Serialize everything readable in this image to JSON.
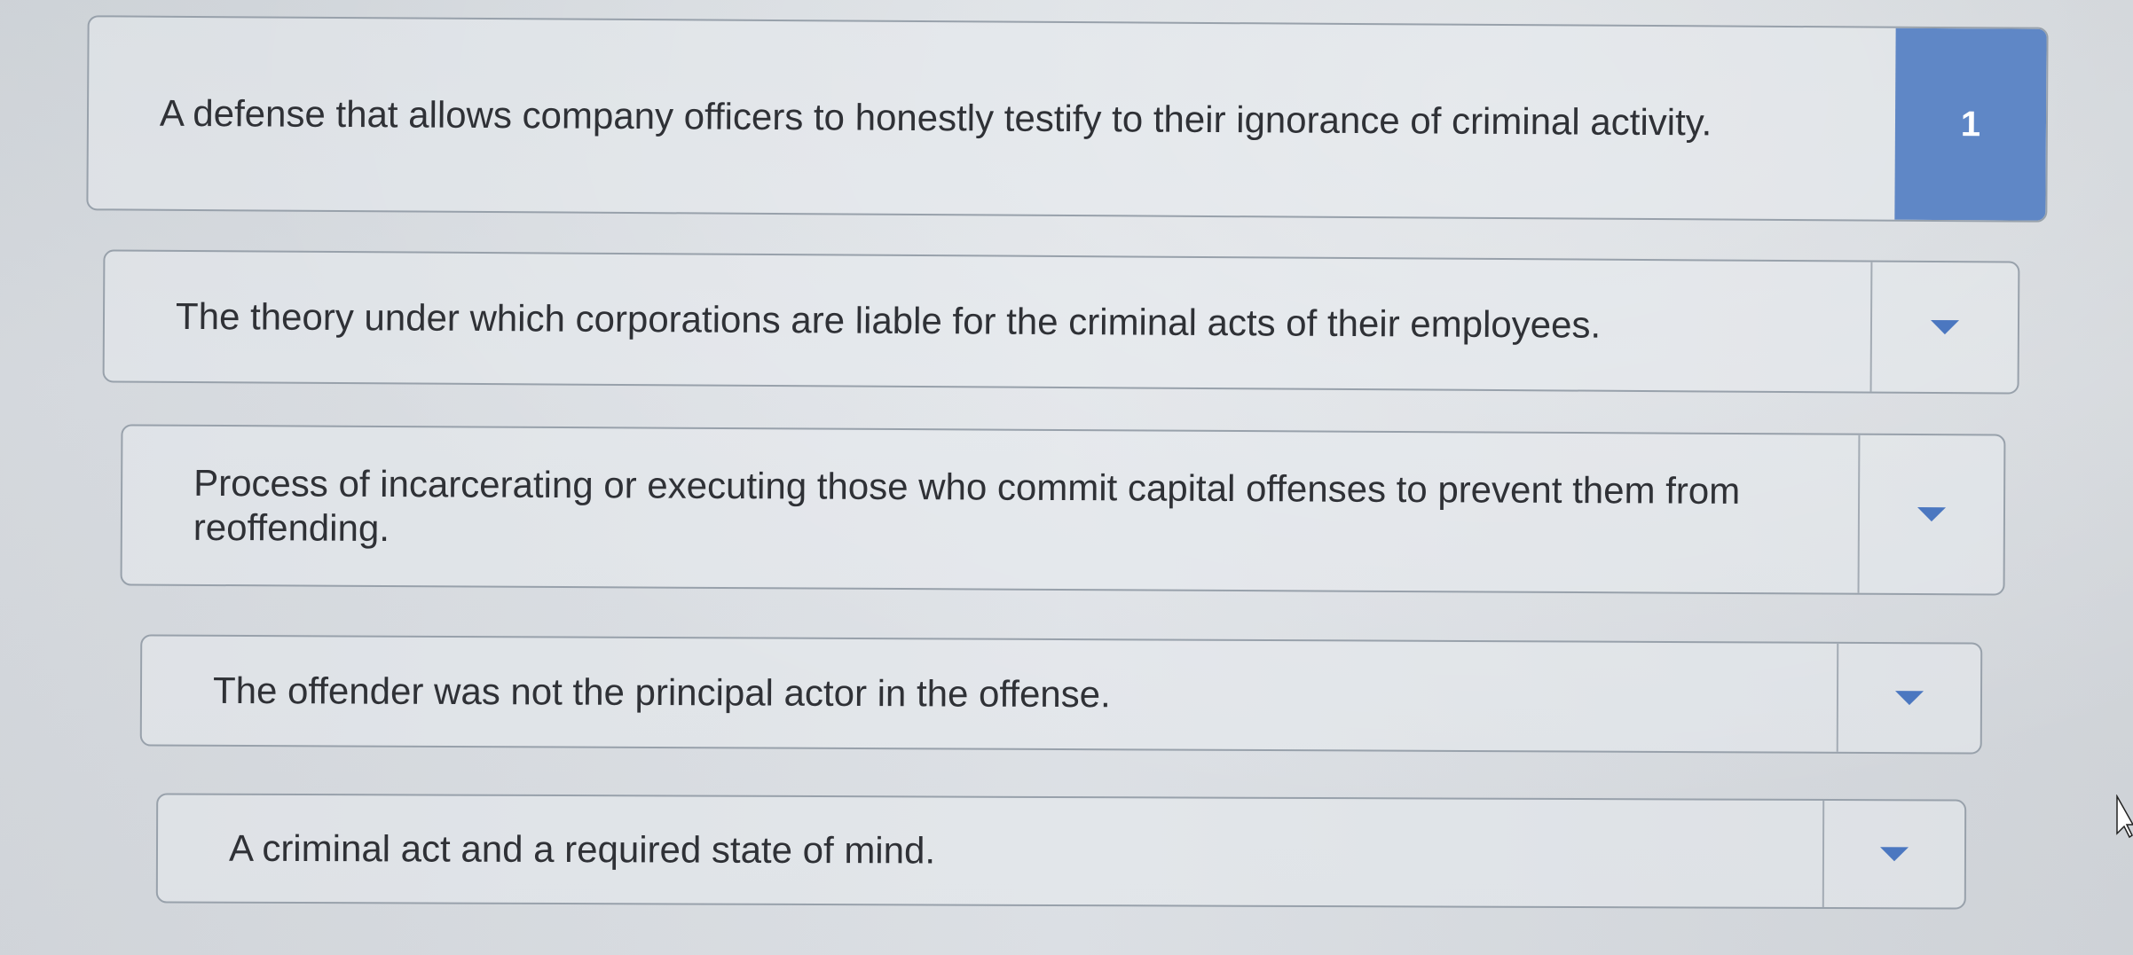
{
  "items": [
    {
      "text": "A defense that allows company officers to honestly testify to their ignorance of criminal activity.",
      "answer": "1",
      "dropdown_icon": "caret-down-icon"
    },
    {
      "text": "The theory under which corporations are liable for the criminal acts of their employees.",
      "answer": "",
      "dropdown_icon": "caret-down-icon"
    },
    {
      "text": "Process of incarcerating or executing those who commit capital offenses to prevent them from reoffending.",
      "answer": "",
      "dropdown_icon": "caret-down-icon"
    },
    {
      "text": "The offender was not the principal actor in the offense.",
      "answer": "",
      "dropdown_icon": "caret-down-icon"
    },
    {
      "text": "A criminal act and a required state of mind.",
      "answer": "",
      "dropdown_icon": "caret-down-icon"
    }
  ],
  "colors": {
    "selected_slot": "#5f87c6",
    "caret": "#4b77c0",
    "text": "#2f3136",
    "border": "#98a1ab"
  },
  "cursor_icon": "pointer-arrow-icon"
}
